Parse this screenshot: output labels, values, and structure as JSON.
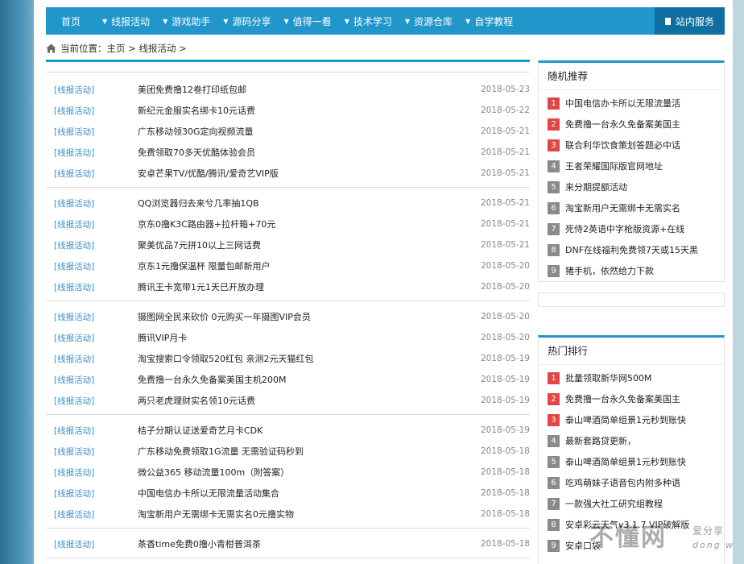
{
  "nav": {
    "home": "首页",
    "items": [
      "线报活动",
      "游戏助手",
      "源码分享",
      "值得一看",
      "技术学习",
      "资源仓库",
      "自学教程"
    ],
    "service": "站内服务"
  },
  "breadcrumb": "当前位置：主页 > 线报活动 >",
  "list": {
    "groups": [
      [
        {
          "cat": "[线报活动]",
          "title": "美团免费撸12卷打印纸包邮",
          "date": "2018-05-23"
        },
        {
          "cat": "[线报活动]",
          "title": "新纪元金服实名绑卡10元话费",
          "date": "2018-05-22"
        },
        {
          "cat": "[线报活动]",
          "title": "广东移动领30G定向视频流量",
          "date": "2018-05-21"
        },
        {
          "cat": "[线报活动]",
          "title": "免费领取70多天优酷体验会员",
          "date": "2018-05-21"
        },
        {
          "cat": "[线报活动]",
          "title": "安卓芒果TV/优酷/腾讯/爱奇艺VIP版",
          "date": "2018-05-21"
        }
      ],
      [
        {
          "cat": "[线报活动]",
          "title": "QQ浏览器归去来兮几率抽1QB",
          "date": "2018-05-21"
        },
        {
          "cat": "[线报活动]",
          "title": "京东0撸K3C路由器+拉杆箱+70元",
          "date": "2018-05-21"
        },
        {
          "cat": "[线报活动]",
          "title": "聚美优品7元拼10以上三网话费",
          "date": "2018-05-21"
        },
        {
          "cat": "[线报活动]",
          "title": "京东1元撸保温杯 限量包邮新用户",
          "date": "2018-05-20"
        },
        {
          "cat": "[线报活动]",
          "title": "腾讯王卡宽带1元1天已开放办理",
          "date": "2018-05-20"
        }
      ],
      [
        {
          "cat": "[线报活动]",
          "title": "摄图网全民来砍价 0元购买一年摄图VIP会员",
          "date": "2018-05-20"
        },
        {
          "cat": "[线报活动]",
          "title": "腾讯VIP月卡",
          "date": "2018-05-20"
        },
        {
          "cat": "[线报活动]",
          "title": "淘宝搜索口令领取520红包 亲测2元天猫红包",
          "date": "2018-05-19"
        },
        {
          "cat": "[线报活动]",
          "title": "免费撸一台永久免备案美国主机200M",
          "date": "2018-05-19"
        },
        {
          "cat": "[线报活动]",
          "title": "两只老虎理财实名领10元话费",
          "date": "2018-05-19"
        }
      ],
      [
        {
          "cat": "[线报活动]",
          "title": "桔子分期认证送爱奇艺月卡CDK",
          "date": "2018-05-19"
        },
        {
          "cat": "[线报活动]",
          "title": "广东移动免费领取1G流量 无需验证码秒到",
          "date": "2018-05-18"
        },
        {
          "cat": "[线报活动]",
          "title": "微公益365 移动流量100m（附答案）",
          "date": "2018-05-18"
        },
        {
          "cat": "[线报活动]",
          "title": "中国电信办卡所以无限流量活动集合",
          "date": "2018-05-18"
        },
        {
          "cat": "[线报活动]",
          "title": "淘宝新用户无需绑卡无需实名0元撸实物",
          "date": "2018-05-18"
        }
      ],
      [
        {
          "cat": "[线报活动]",
          "title": "茶香time免费0撸小青柑普洱茶",
          "date": "2018-05-18"
        }
      ]
    ]
  },
  "random": {
    "title": "随机推荐",
    "items": [
      {
        "n": "1",
        "t": "中国电信办卡所以无限流量活"
      },
      {
        "n": "2",
        "t": "免费撸一台永久免备案美国主"
      },
      {
        "n": "3",
        "t": "联合利华饮食策划答题必中话"
      },
      {
        "n": "4",
        "t": "王者荣耀国际版官网地址"
      },
      {
        "n": "5",
        "t": "来分期提额活动"
      },
      {
        "n": "6",
        "t": "淘宝新用户无需绑卡无需实名"
      },
      {
        "n": "7",
        "t": "死侍2英语中字枪版资源+在线"
      },
      {
        "n": "8",
        "t": "DNF在线福利免费领7天或15天黑"
      },
      {
        "n": "9",
        "t": "猪手机，依然给力下款"
      }
    ]
  },
  "hot": {
    "title": "热门排行",
    "items": [
      {
        "n": "1",
        "t": "批量领取新华网500M"
      },
      {
        "n": "2",
        "t": "免费撸一台永久免备案美国主"
      },
      {
        "n": "3",
        "t": "泰山啤酒简单组景1元秒到账快"
      },
      {
        "n": "4",
        "t": "最新套路贷更新，"
      },
      {
        "n": "5",
        "t": "泰山啤酒简单组景1元秒到账快"
      },
      {
        "n": "6",
        "t": "吃鸡萌妹子语音包内附多种语"
      },
      {
        "n": "7",
        "t": "一款强大社工研究组教程"
      },
      {
        "n": "8",
        "t": "安卓彩云天气v3.1.7 VIP破解版"
      },
      {
        "n": "9",
        "t": "安卓口袋"
      }
    ]
  },
  "watermark": {
    "big": "不懂网",
    "small": "爱分享",
    "latin": "dong wang"
  }
}
